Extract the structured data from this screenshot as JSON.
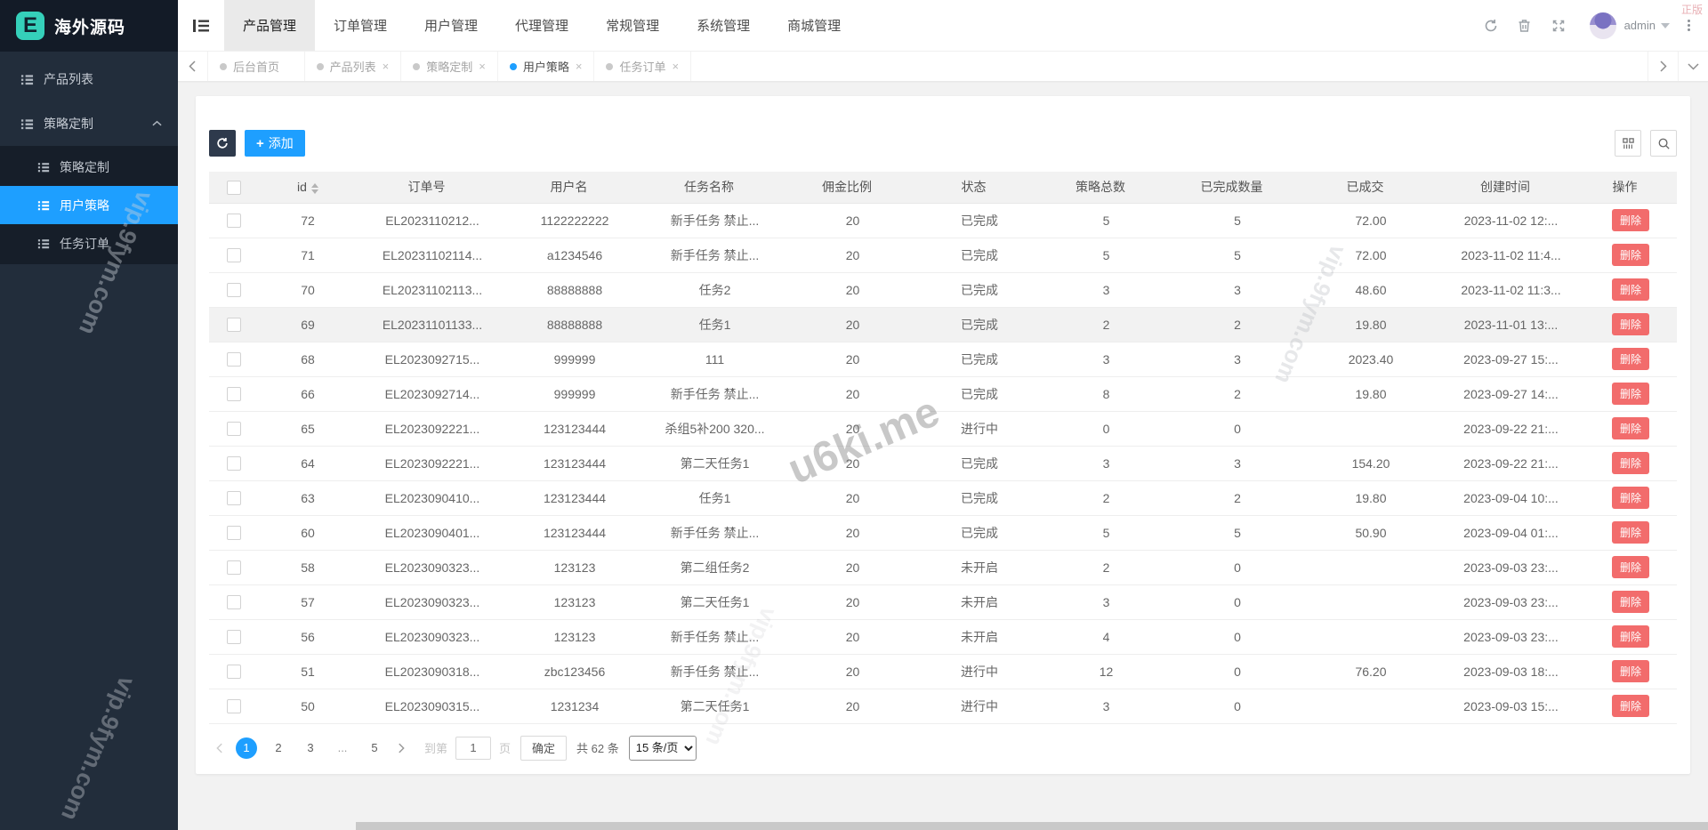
{
  "watermarks": {
    "sidebar_top": "vip.9fym.com",
    "sidebar_bottom": "vip.9fym.com",
    "center": "u6ki.me",
    "right": "vip.9fym.com",
    "bottom": "vip.9fym.com",
    "corner": "正版"
  },
  "sidebar": {
    "logo_letter": "E",
    "logo_text": "海外源码",
    "items": [
      {
        "label": "产品列表"
      },
      {
        "label": "策略定制",
        "group": true
      }
    ],
    "submenu": [
      {
        "label": "策略定制"
      },
      {
        "label": "用户策略",
        "active": true
      },
      {
        "label": "任务订单"
      }
    ]
  },
  "header": {
    "nav": [
      {
        "label": "产品管理",
        "active": true
      },
      {
        "label": "订单管理"
      },
      {
        "label": "用户管理"
      },
      {
        "label": "代理管理"
      },
      {
        "label": "常规管理"
      },
      {
        "label": "系统管理"
      },
      {
        "label": "商城管理"
      }
    ],
    "username": "admin"
  },
  "tabs": [
    {
      "label": "后台首页",
      "closable": false
    },
    {
      "label": "产品列表",
      "closable": true
    },
    {
      "label": "策略定制",
      "closable": true
    },
    {
      "label": "用户策略",
      "closable": true,
      "active": true
    },
    {
      "label": "任务订单",
      "closable": true
    }
  ],
  "toolbar": {
    "plus": "+",
    "add_label": "添加"
  },
  "table": {
    "columns": [
      {
        "label": "id",
        "sortable": true
      },
      {
        "label": "订单号"
      },
      {
        "label": "用户名"
      },
      {
        "label": "任务名称"
      },
      {
        "label": "佣金比例"
      },
      {
        "label": "状态"
      },
      {
        "label": "策略总数"
      },
      {
        "label": "已完成数量"
      },
      {
        "label": "已成交"
      },
      {
        "label": "创建时间"
      },
      {
        "label": "操作"
      }
    ],
    "rows": [
      {
        "id": "72",
        "order": "EL2023110212...",
        "user": "1122222222",
        "task": "新手任务 禁止...",
        "rate": "20",
        "status": "已完成",
        "total": "5",
        "done": "5",
        "deal": "72.00",
        "created": "2023-11-02 12:...",
        "op": "删除"
      },
      {
        "id": "71",
        "order": "EL20231102114...",
        "user": "a1234546",
        "task": "新手任务 禁止...",
        "rate": "20",
        "status": "已完成",
        "total": "5",
        "done": "5",
        "deal": "72.00",
        "created": "2023-11-02 11:4...",
        "op": "删除"
      },
      {
        "id": "70",
        "order": "EL20231102113...",
        "user": "88888888",
        "task": "任务2",
        "rate": "20",
        "status": "已完成",
        "total": "3",
        "done": "3",
        "deal": "48.60",
        "created": "2023-11-02 11:3...",
        "op": "删除"
      },
      {
        "id": "69",
        "order": "EL20231101133...",
        "user": "88888888",
        "task": "任务1",
        "rate": "20",
        "status": "已完成",
        "total": "2",
        "done": "2",
        "deal": "19.80",
        "created": "2023-11-01 13:...",
        "op": "删除",
        "hl": true
      },
      {
        "id": "68",
        "order": "EL2023092715...",
        "user": "999999",
        "task": "111",
        "rate": "20",
        "status": "已完成",
        "total": "3",
        "done": "3",
        "deal": "2023.40",
        "created": "2023-09-27 15:...",
        "op": "删除"
      },
      {
        "id": "66",
        "order": "EL2023092714...",
        "user": "999999",
        "task": "新手任务 禁止...",
        "rate": "20",
        "status": "已完成",
        "total": "8",
        "done": "2",
        "deal": "19.80",
        "created": "2023-09-27 14:...",
        "op": "删除"
      },
      {
        "id": "65",
        "order": "EL2023092221...",
        "user": "123123444",
        "task": "杀组5补200 320...",
        "rate": "20",
        "status": "进行中",
        "total": "0",
        "done": "0",
        "deal": "",
        "created": "2023-09-22 21:...",
        "op": "删除"
      },
      {
        "id": "64",
        "order": "EL2023092221...",
        "user": "123123444",
        "task": "第二天任务1",
        "rate": "20",
        "status": "已完成",
        "total": "3",
        "done": "3",
        "deal": "154.20",
        "created": "2023-09-22 21:...",
        "op": "删除"
      },
      {
        "id": "63",
        "order": "EL2023090410...",
        "user": "123123444",
        "task": "任务1",
        "rate": "20",
        "status": "已完成",
        "total": "2",
        "done": "2",
        "deal": "19.80",
        "created": "2023-09-04 10:...",
        "op": "删除"
      },
      {
        "id": "60",
        "order": "EL2023090401...",
        "user": "123123444",
        "task": "新手任务 禁止...",
        "rate": "20",
        "status": "已完成",
        "total": "5",
        "done": "5",
        "deal": "50.90",
        "created": "2023-09-04 01:...",
        "op": "删除"
      },
      {
        "id": "58",
        "order": "EL2023090323...",
        "user": "123123",
        "task": "第二组任务2",
        "rate": "20",
        "status": "未开启",
        "total": "2",
        "done": "0",
        "deal": "",
        "created": "2023-09-03 23:...",
        "op": "删除"
      },
      {
        "id": "57",
        "order": "EL2023090323...",
        "user": "123123",
        "task": "第二天任务1",
        "rate": "20",
        "status": "未开启",
        "total": "3",
        "done": "0",
        "deal": "",
        "created": "2023-09-03 23:...",
        "op": "删除"
      },
      {
        "id": "56",
        "order": "EL2023090323...",
        "user": "123123",
        "task": "新手任务 禁止...",
        "rate": "20",
        "status": "未开启",
        "total": "4",
        "done": "0",
        "deal": "",
        "created": "2023-09-03 23:...",
        "op": "删除"
      },
      {
        "id": "51",
        "order": "EL2023090318...",
        "user": "zbc123456",
        "task": "新手任务 禁止...",
        "rate": "20",
        "status": "进行中",
        "total": "12",
        "done": "0",
        "deal": "76.20",
        "created": "2023-09-03 18:...",
        "op": "删除"
      },
      {
        "id": "50",
        "order": "EL2023090315...",
        "user": "1231234",
        "task": "第二天任务1",
        "rate": "20",
        "status": "进行中",
        "total": "3",
        "done": "0",
        "deal": "",
        "created": "2023-09-03 15:...",
        "op": "删除"
      }
    ]
  },
  "pagination": {
    "pages": [
      {
        "label": "1",
        "active": true
      },
      {
        "label": "2"
      },
      {
        "label": "3"
      },
      {
        "label": "...",
        "dots": true
      },
      {
        "label": "5"
      }
    ],
    "goto_label": "到第",
    "goto_value": "1",
    "page_unit": "页",
    "confirm_label": "确定",
    "total_label": "共 62 条",
    "page_size_label": "15 条/页"
  },
  "colors": {
    "accent": "#1e9fff",
    "danger": "#f26c6c",
    "sidebar_bg": "#222d3b",
    "logo_teal": "#35d0ba"
  }
}
